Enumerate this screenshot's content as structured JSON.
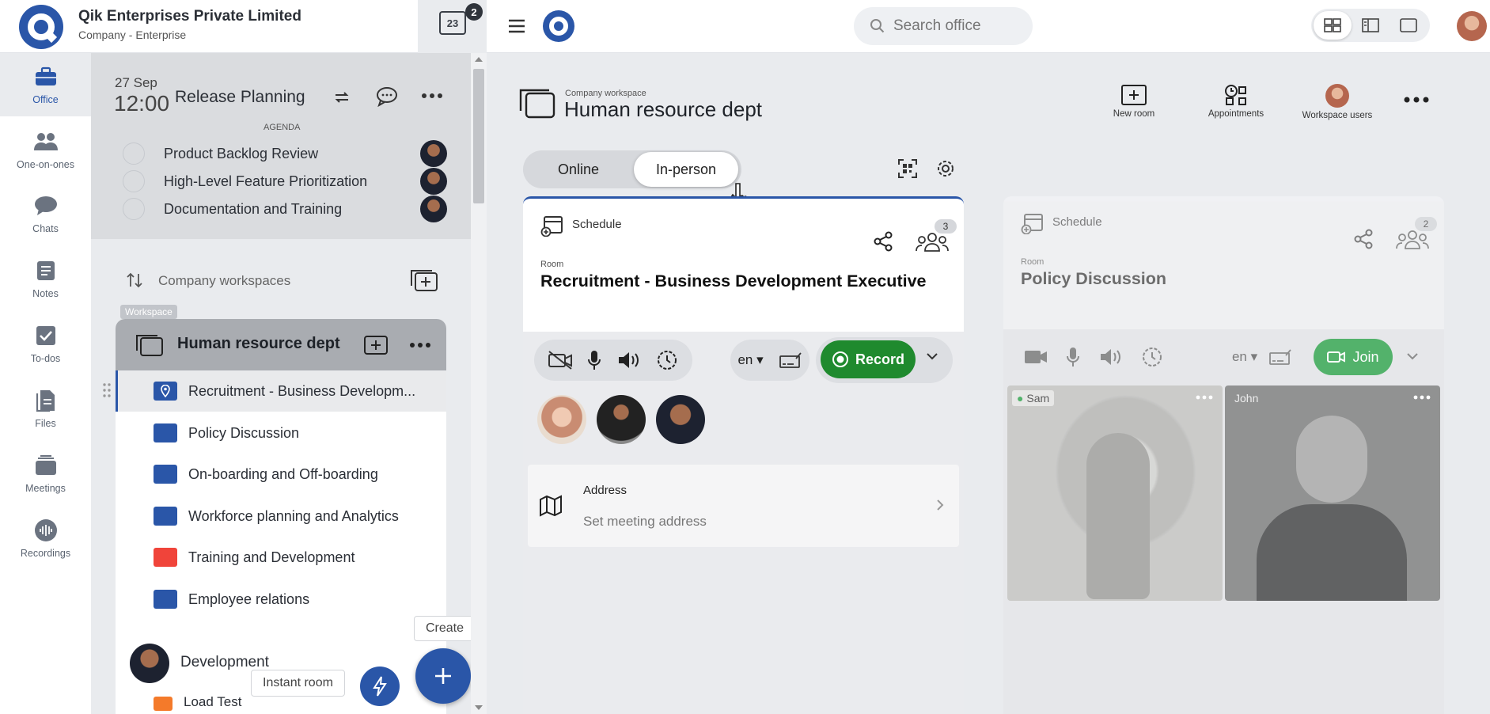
{
  "org": {
    "name": "Qik Enterprises Private Limited",
    "type": "Company - Enterprise"
  },
  "calendar": {
    "day": "23",
    "badge": "2"
  },
  "search": {
    "placeholder": "Search office"
  },
  "nav": [
    {
      "label": "Office",
      "icon": "briefcase-icon"
    },
    {
      "label": "One-on-ones",
      "icon": "people-icon"
    },
    {
      "label": "Chats",
      "icon": "chat-icon"
    },
    {
      "label": "Notes",
      "icon": "notes-icon"
    },
    {
      "label": "To-dos",
      "icon": "checkbox-icon"
    },
    {
      "label": "Files",
      "icon": "files-icon"
    },
    {
      "label": "Meetings",
      "icon": "meetings-icon"
    },
    {
      "label": "Recordings",
      "icon": "waveform-icon"
    }
  ],
  "meeting": {
    "date": "27 Sep",
    "time": "12:00",
    "title": "Release Planning",
    "agenda_label": "AGENDA",
    "agenda": [
      "Product Backlog Review",
      "High-Level Feature Prioritization",
      "Documentation and Training"
    ]
  },
  "workspaces": {
    "header": "Company workspaces",
    "tooltip": "Workspace",
    "current": "Human resource dept",
    "rooms": [
      {
        "name": "Recruitment - Business Developm...",
        "color": "#2a56a8",
        "location": true
      },
      {
        "name": "Policy Discussion",
        "color": "#2a56a8"
      },
      {
        "name": "On-boarding and Off-boarding",
        "color": "#2a56a8"
      },
      {
        "name": "Workforce planning and Analytics",
        "color": "#2a56a8"
      },
      {
        "name": "Training and Development",
        "color": "#f0443a"
      },
      {
        "name": "Employee relations",
        "color": "#2a56a8"
      }
    ],
    "next": {
      "name": "Development",
      "room": "Load Test",
      "room_color": "#f47a2a"
    }
  },
  "fab": {
    "create": "Create",
    "instant": "Instant room"
  },
  "workspace_header": {
    "subtitle": "Company workspace",
    "title": "Human resource dept",
    "actions": {
      "new_room": "New room",
      "appointments": "Appointments",
      "users": "Workspace users"
    }
  },
  "mode_toggle": {
    "online": "Online",
    "in_person": "In-person",
    "selected": "In-person"
  },
  "room_cards": [
    {
      "schedule": "Schedule",
      "count": "3",
      "room_label": "Room",
      "title": "Recruitment - Business Development Executive",
      "lang": "en",
      "action": "Record",
      "address_label": "Address",
      "address_placeholder": "Set meeting address"
    },
    {
      "schedule": "Schedule",
      "count": "2",
      "room_label": "Room",
      "title": "Policy Discussion",
      "lang": "en",
      "action": "Join",
      "participants": [
        "Sam",
        "John"
      ]
    }
  ],
  "colors": {
    "brand": "#2a56a8",
    "record": "#1f8a2e",
    "join": "#4caf65"
  }
}
